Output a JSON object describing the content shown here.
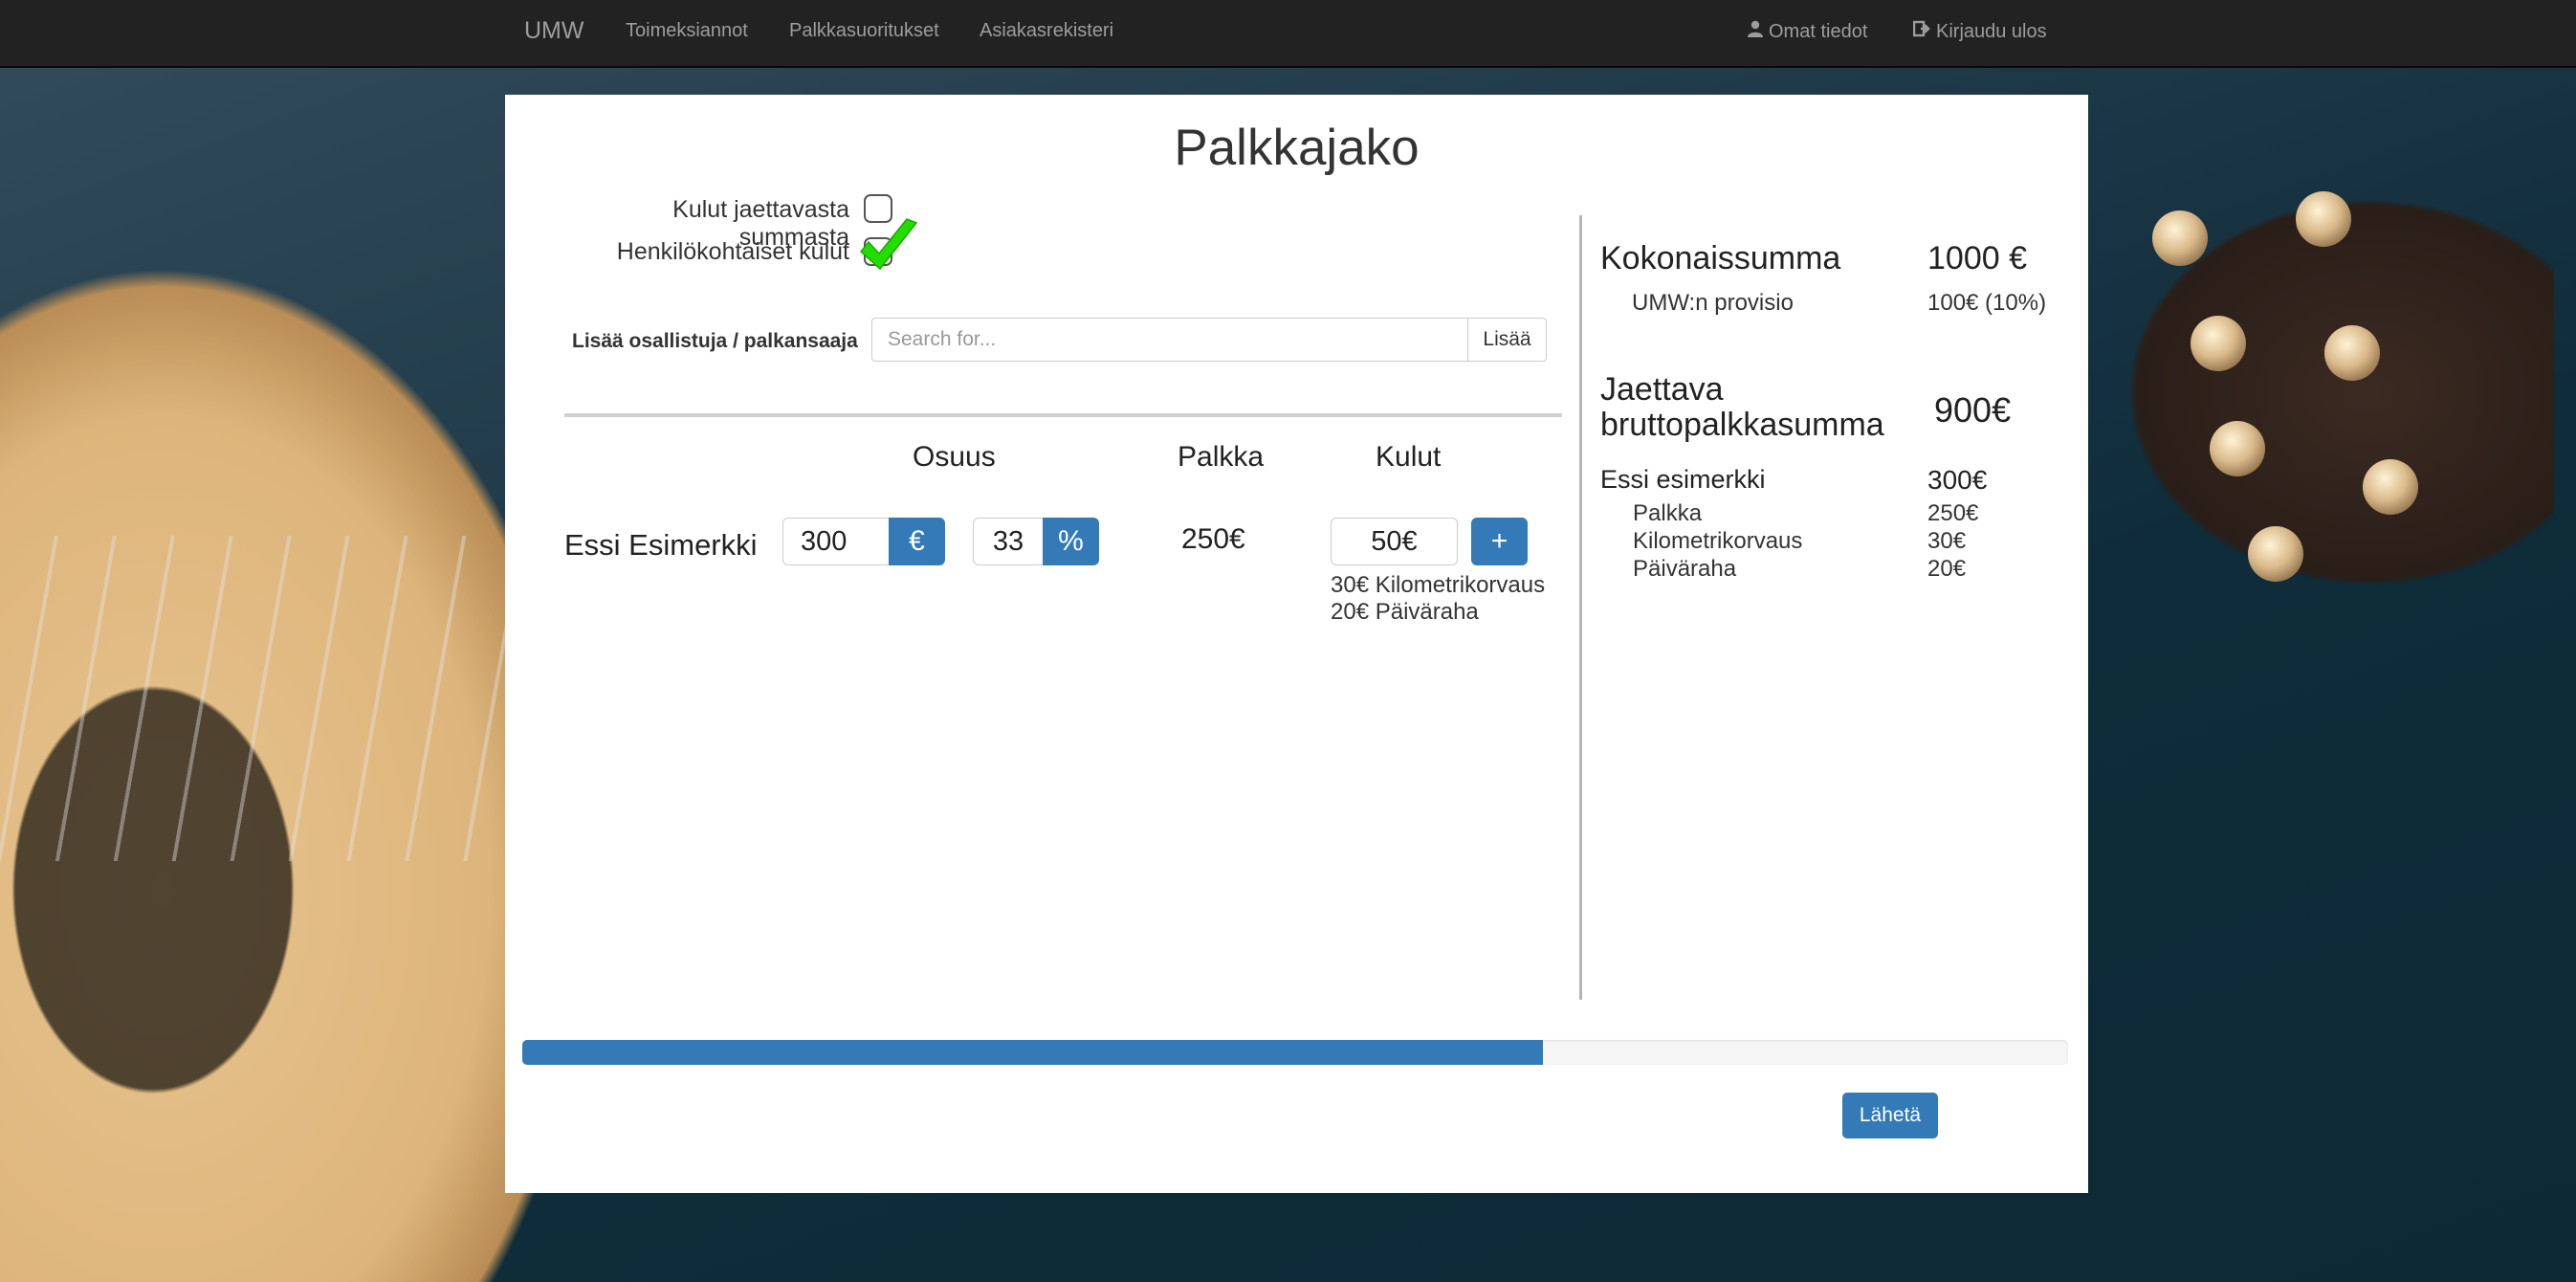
{
  "navbar": {
    "brand": "UMW",
    "links": [
      "Toimeksiannot",
      "Palkkasuoritukset",
      "Asiakasrekisteri"
    ],
    "profile_label": "Omat tiedot",
    "profile_icon": "user-icon",
    "logout_label": "Kirjaudu ulos",
    "logout_icon": "logout-icon"
  },
  "page": {
    "title": "Palkkajako",
    "options": {
      "expenses_from_total_label": "Kulut jaettavasta summasta",
      "expenses_from_total_checked": false,
      "personal_expenses_label": "Henkilökohtaiset kulut",
      "personal_expenses_checked": true
    },
    "add_participant": {
      "label": "Lisää osallistuja / palkansaaja",
      "search_placeholder": "Search for...",
      "search_value": "",
      "add_button": "Lisää"
    },
    "columns": {
      "share": "Osuus",
      "salary": "Palkka",
      "expenses": "Kulut"
    },
    "participants": [
      {
        "name": "Essi Esimerkki",
        "share_amount": "300",
        "share_amount_unit": "€",
        "share_percent": "33",
        "share_percent_unit": "%",
        "salary": "250€",
        "expenses_total": "50€",
        "add_expense_button": "+",
        "expense_items": [
          "30€ Kilometrikorvaus",
          "20€ Päiväraha"
        ]
      }
    ]
  },
  "summary": {
    "total_label": "Kokonaissumma",
    "total_value": "1000 €",
    "commission_label": "UMW:n provisio",
    "commission_value": "100€ (10%)",
    "distributable_label_line1": "Jaettava",
    "distributable_label_line2": "bruttopalkkasumma",
    "distributable_value": "900€",
    "person_label": "Essi esimerkki",
    "person_value": "300€",
    "breakdown": [
      {
        "label": "Palkka",
        "value": "250€"
      },
      {
        "label": "Kilometrikorvaus",
        "value": "30€"
      },
      {
        "label": "Päiväraha",
        "value": "20€"
      }
    ]
  },
  "progress": {
    "percent": 66
  },
  "send_button": "Lähetä",
  "colors": {
    "navbar": "#222222",
    "primary": "#337ab7",
    "checkmark": "#22dd00"
  }
}
